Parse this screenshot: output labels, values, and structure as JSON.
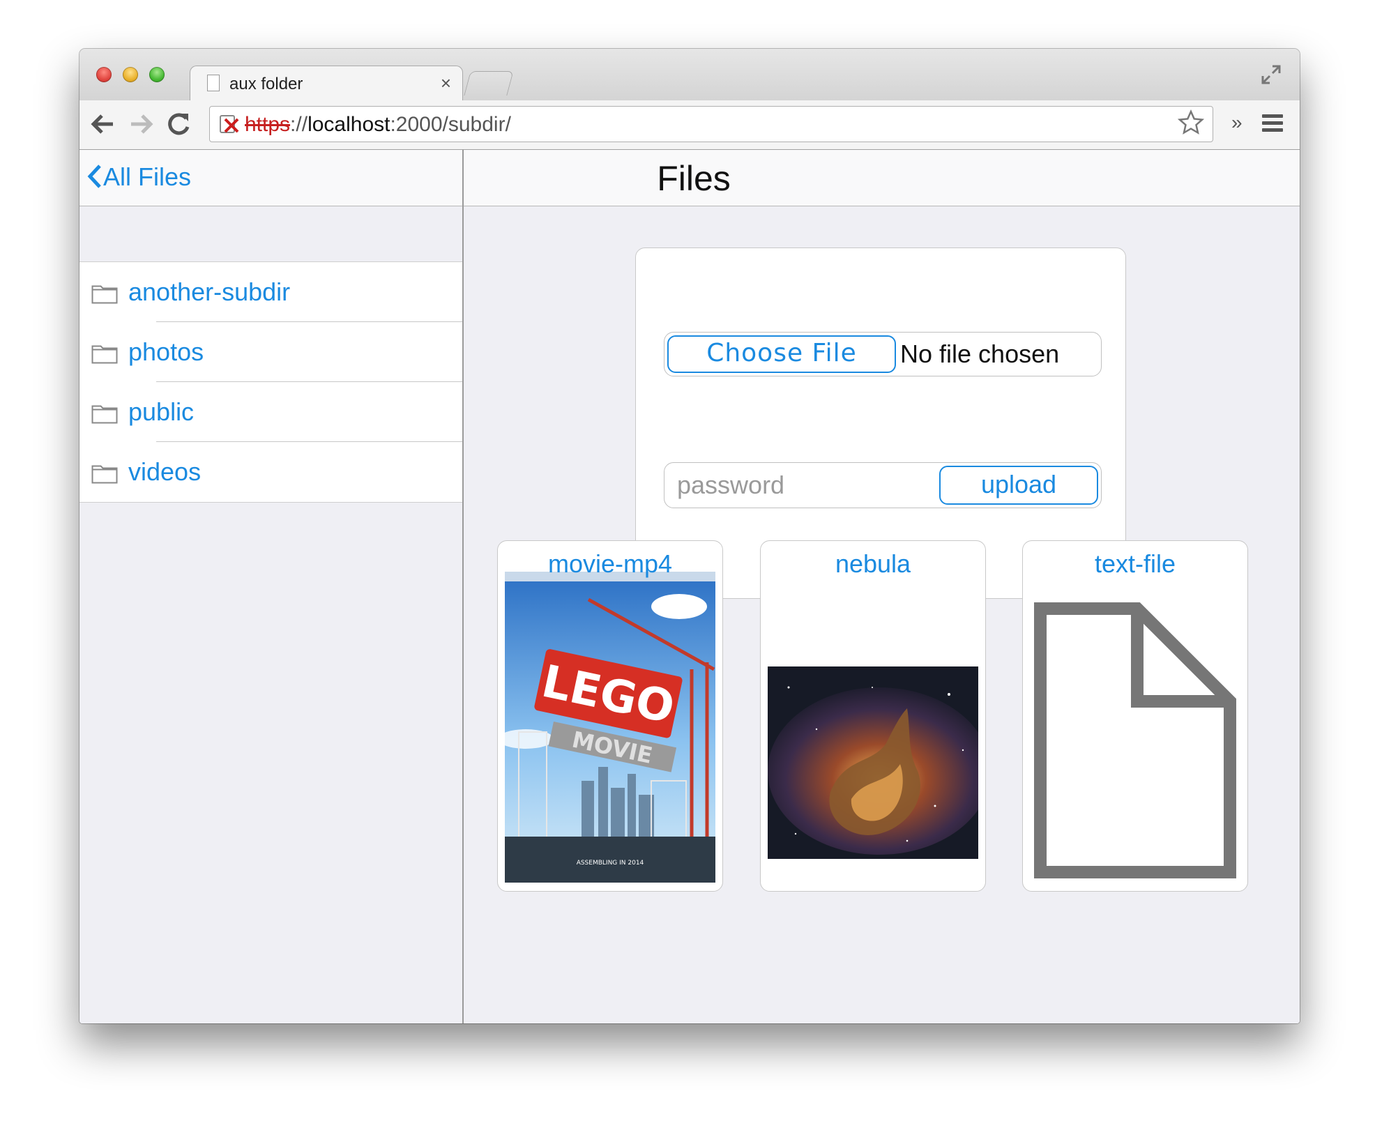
{
  "browser": {
    "tab_title": "aux folder",
    "tab_close": "×",
    "url_scheme": "https",
    "url_sep": "://",
    "url_host": "localhost",
    "url_rest": ":2000/subdir/",
    "extend_label": "»"
  },
  "sidebar": {
    "back_label": "All Files",
    "folders": [
      {
        "label": "another-subdir"
      },
      {
        "label": "photos"
      },
      {
        "label": "public"
      },
      {
        "label": "videos"
      }
    ]
  },
  "main": {
    "title": "Files",
    "upload": {
      "choose_label": "Choose File",
      "no_file_label": "No file chosen",
      "password_placeholder": "password",
      "upload_label": "upload"
    },
    "files": [
      {
        "label": "movie-mp4",
        "kind": "video"
      },
      {
        "label": "nebula",
        "kind": "image"
      },
      {
        "label": "text-file",
        "kind": "document"
      }
    ]
  },
  "colors": {
    "accent": "#1a8ae0",
    "background": "#efeff4"
  },
  "icons": [
    "back-arrow-icon",
    "forward-arrow-icon",
    "reload-icon",
    "insecure-lock-icon",
    "star-icon",
    "menu-icon",
    "folder-icon",
    "document-icon",
    "fullscreen-icon"
  ]
}
